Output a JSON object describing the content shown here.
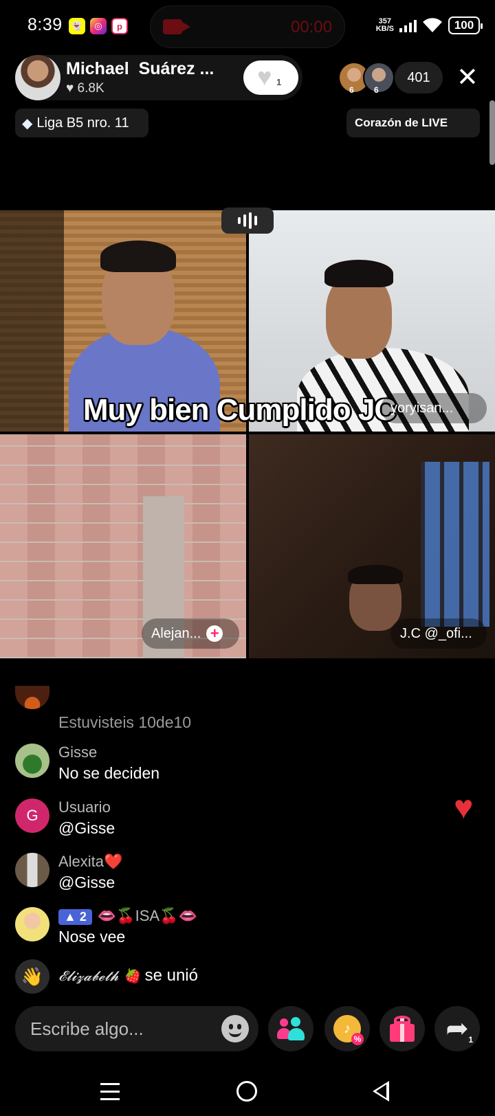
{
  "status_bar": {
    "time": "8:39",
    "app_icons": [
      "snapchat-icon",
      "instagram-icon",
      "app-icon"
    ],
    "recording_time": "00:00",
    "net_speed_value": "357",
    "net_speed_unit": "KB/S",
    "battery": "100"
  },
  "host": {
    "name": "Michael  Suárez ...",
    "likes": "♥ 6.8K",
    "follow_count": "1"
  },
  "viewers": {
    "badge_1": "6",
    "badge_2": "6",
    "count": "401"
  },
  "league": {
    "label": "Liga B5 nro. 11"
  },
  "ranking": {
    "label": "Corazón de LIVE"
  },
  "video": {
    "caption": "Muy bien Cumplido JC",
    "guests": [
      {
        "label": ""
      },
      {
        "label": "yoryisan..."
      },
      {
        "label": "Alejan..."
      },
      {
        "label": "J.C @_ofi..."
      }
    ]
  },
  "comments": [
    {
      "name": "",
      "text": "Estuvisteis 10de10"
    },
    {
      "name": "Gisse",
      "text": "No se deciden"
    },
    {
      "name": "Usuario",
      "text": "@Gisse",
      "avatar_letter": "G"
    },
    {
      "name": "Alexita❤️",
      "text": "@Gisse"
    },
    {
      "name": "👄🍒ISA🍒👄",
      "text": "Nose vee",
      "level": "▲ 2"
    }
  ],
  "join_event": {
    "name": "𝓔𝓵𝓲𝔃𝓪𝓫𝓮𝓽𝓱 🍓",
    "text": "se unió"
  },
  "bottom_bar": {
    "input_placeholder": "Escribe algo...",
    "share_count": "1"
  },
  "colors": {
    "background": "#000000",
    "accent_pink": "#ff2a6d",
    "heart_red": "#e8303a",
    "level_badge": "#4864d6"
  }
}
